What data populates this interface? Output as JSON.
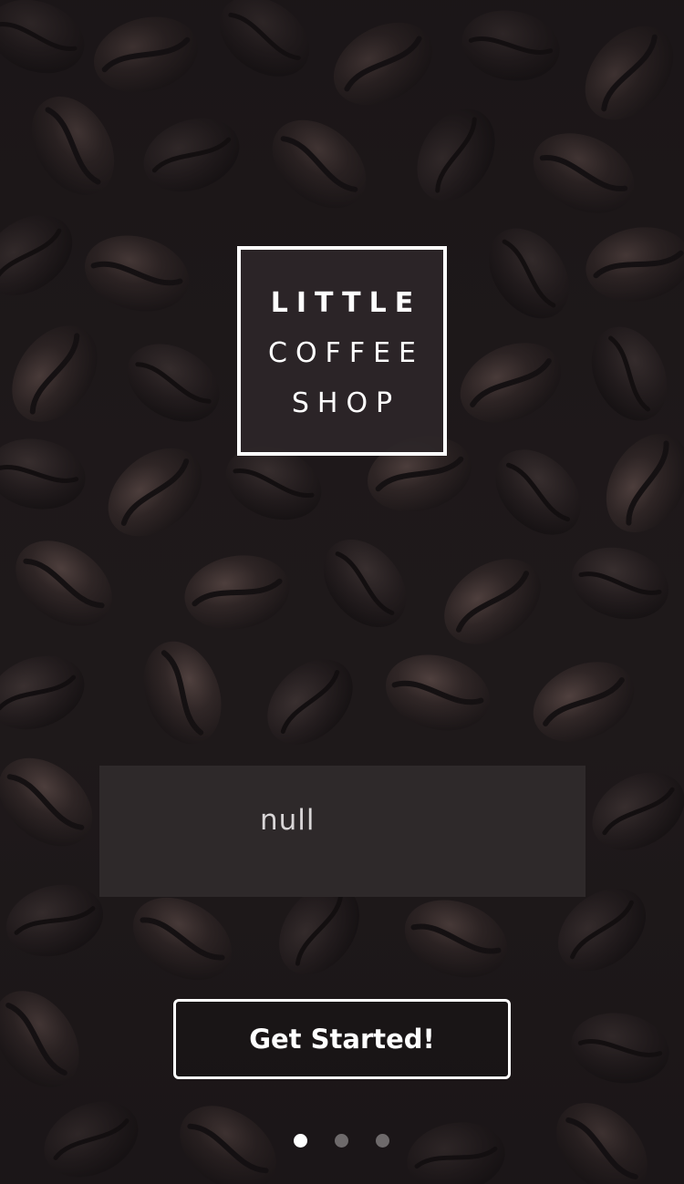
{
  "logo": {
    "line1": "LITTLE",
    "line2": "COFFEE",
    "line3": "SHOP"
  },
  "message_panel": {
    "text": "null"
  },
  "cta": {
    "label": "Get Started!"
  },
  "pagination": {
    "total": 3,
    "active_index": 0
  },
  "background": {
    "icon": "coffee-beans-photo",
    "tint": "#2a2425"
  }
}
